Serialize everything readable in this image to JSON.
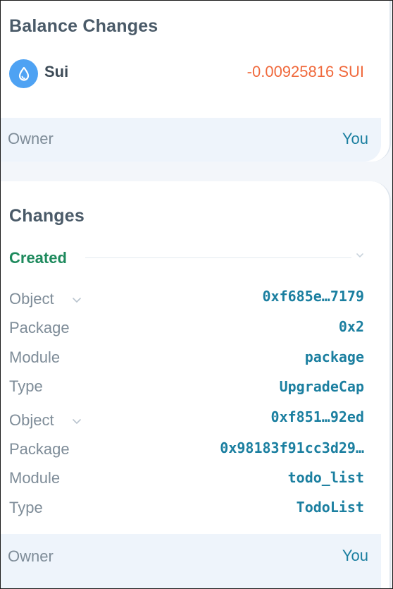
{
  "balance": {
    "title": "Balance Changes",
    "coin_name": "Sui",
    "amount": "-0.00925816 SUI",
    "owner_label": "Owner",
    "owner_value": "You"
  },
  "changes": {
    "title": "Changes",
    "created_label": "Created",
    "objects": [
      {
        "object_label": "Object",
        "object_id": "0xf685e…7179",
        "package_label": "Package",
        "package": "0x2",
        "module_label": "Module",
        "module": "package",
        "type_label": "Type",
        "type": "UpgradeCap"
      },
      {
        "object_label": "Object",
        "object_id": "0xf851…92ed",
        "package_label": "Package",
        "package": "0x98183f91cc3d29…",
        "module_label": "Module",
        "module": "todo_list",
        "type_label": "Type",
        "type": "TodoList"
      }
    ],
    "owner_label": "Owner",
    "owner_value": "You"
  },
  "colors": {
    "negative_amount": "#f0693c",
    "created": "#1e8a5d",
    "link_value": "#1b7fa0",
    "coin_icon": "#4ea2f3"
  },
  "icons": {
    "coin": "sui-drop-icon",
    "expand": "chevron-down-icon"
  }
}
